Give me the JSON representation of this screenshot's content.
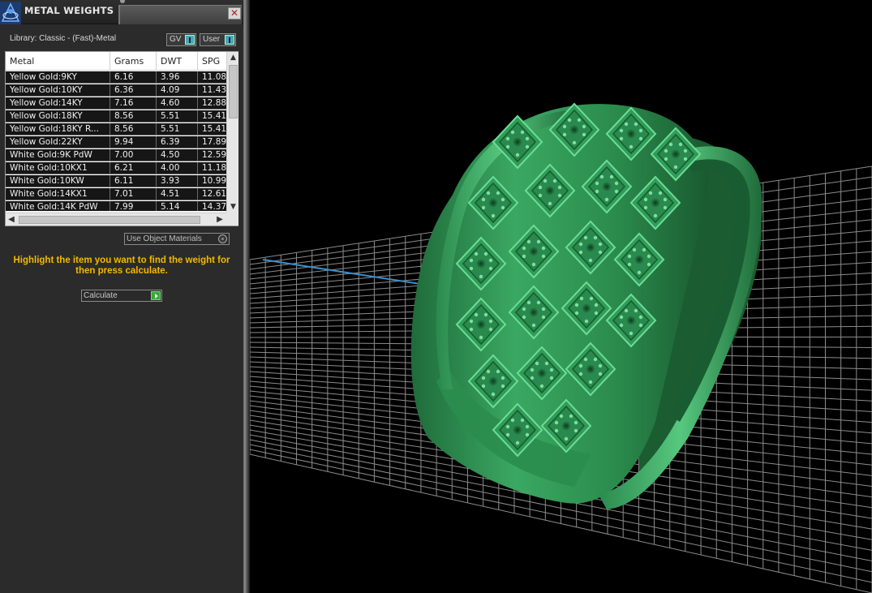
{
  "panel": {
    "title": "METAL WEIGHTS",
    "close_glyph": "✕",
    "library_label": "Library: Classic - (Fast)-Metal",
    "toggle_gv": "GV",
    "toggle_user": "User",
    "use_object_materials": "Use Object Materials",
    "hint": "Highlight the item you want to find the weight for then press calculate.",
    "calculate": "Calculate"
  },
  "table": {
    "columns": [
      "Metal",
      "Grams",
      "DWT",
      "SPG"
    ],
    "rows": [
      [
        "Yellow Gold:9KY",
        "6.16",
        "3.96",
        "11.08"
      ],
      [
        "Yellow Gold:10KY",
        "6.36",
        "4.09",
        "11.43"
      ],
      [
        "Yellow Gold:14KY",
        "7.16",
        "4.60",
        "12.88"
      ],
      [
        "Yellow Gold:18KY",
        "8.56",
        "5.51",
        "15.41"
      ],
      [
        "Yellow Gold:18KY R...",
        "8.56",
        "5.51",
        "15.41"
      ],
      [
        "Yellow Gold:22KY",
        "9.94",
        "6.39",
        "17.89"
      ],
      [
        "White Gold:9K PdW",
        "7.00",
        "4.50",
        "12.59"
      ],
      [
        "White Gold:10KX1",
        "6.21",
        "4.00",
        "11.18"
      ],
      [
        "White Gold:10KW",
        "6.11",
        "3.93",
        "10.99"
      ],
      [
        "White Gold:14KX1",
        "7.01",
        "4.51",
        "12.61"
      ],
      [
        "White Gold:14K PdW",
        "7.99",
        "5.14",
        "14.37"
      ]
    ]
  },
  "icons": {
    "logo": "app-logo-icon",
    "close": "close-icon",
    "scroll_up": "scroll-up-icon",
    "scroll_down": "scroll-down-icon",
    "scroll_left": "scroll-left-icon",
    "scroll_right": "scroll-right-icon",
    "calculate_go": "play-arrow-icon"
  },
  "colors": {
    "hint": "#f5b800",
    "ring": "#2f9a55",
    "grid": "#8a8a8a",
    "axis": "#3a8fc8"
  }
}
